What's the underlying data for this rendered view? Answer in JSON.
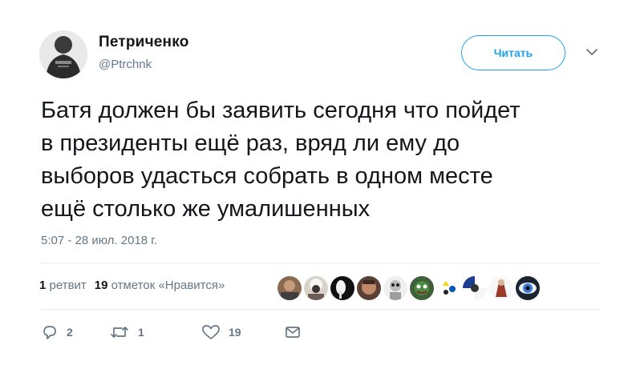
{
  "author": {
    "name": "Петриченко",
    "handle": "@Ptrchnk"
  },
  "follow_button_label": "Читать",
  "tweet": {
    "text": "Батя должен бы заявить сегодня что пойдет\nв президенты ещё раз, вряд ли ему до\nвыборов удасться собрать в одном месте\nещё столько же умалишенных",
    "timestamp": "5:07 - 28 июл. 2018 г."
  },
  "stats": {
    "retweets_count": "1",
    "retweets_label": "ретвит",
    "likes_count": "19",
    "likes_label": "отметок «Нравится»"
  },
  "liker_avatars_count": 10,
  "actions": {
    "reply_count": "2",
    "retweet_count": "1",
    "like_count": "19"
  },
  "colors": {
    "accent": "#1da1f2",
    "secondary_text": "#657786",
    "divider": "#e6ecf0"
  },
  "icons": [
    "chevron-down-icon",
    "reply-icon",
    "retweet-icon",
    "heart-icon",
    "envelope-icon"
  ]
}
